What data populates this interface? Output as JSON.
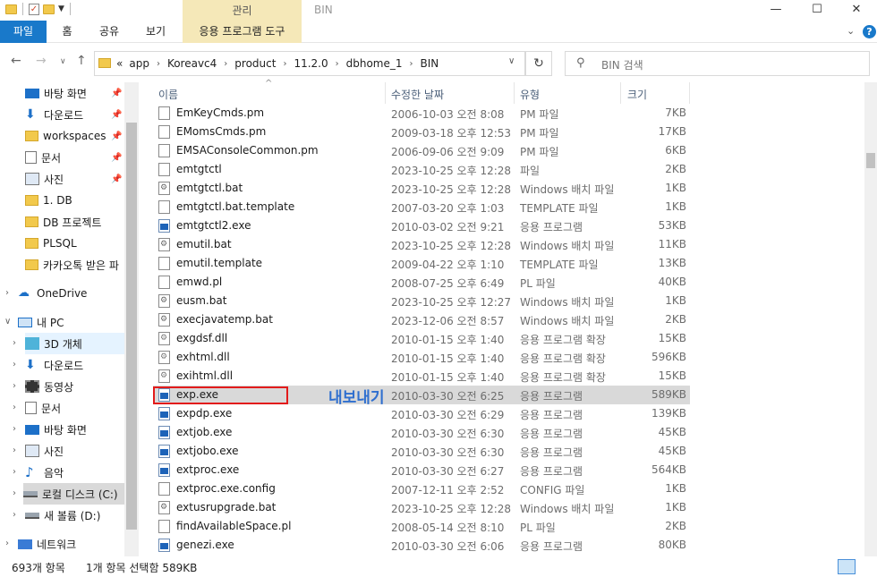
{
  "title_bar": {
    "contextual_tab": "관리",
    "window_title": "BIN",
    "minimize": "—",
    "maximize": "☐",
    "close": "✕"
  },
  "ribbon": {
    "file": "파일",
    "home": "홈",
    "share": "공유",
    "view": "보기",
    "app_tools": "응용 프로그램 도구"
  },
  "address": {
    "overflow": "«",
    "crumbs": [
      "app",
      "Koreavc4",
      "product",
      "11.2.0",
      "dbhome_1",
      "BIN"
    ]
  },
  "search": {
    "placeholder": "BIN 검색"
  },
  "sidebar": {
    "items": [
      {
        "label": "바탕 화면",
        "icon": "desktop-icon"
      },
      {
        "label": "다운로드",
        "icon": "download-arrow-icon"
      },
      {
        "label": "workspaces",
        "icon": "folder-icon"
      },
      {
        "label": "문서",
        "icon": "document-icon"
      },
      {
        "label": "사진",
        "icon": "picture-icon"
      },
      {
        "label": "1. DB",
        "icon": "folder-icon"
      },
      {
        "label": "DB 프로젝트",
        "icon": "folder-icon"
      },
      {
        "label": "PLSQL",
        "icon": "folder-icon"
      },
      {
        "label": "카카오톡 받은 파",
        "icon": "folder-icon"
      },
      {
        "label": "OneDrive",
        "icon": "cloud-icon"
      },
      {
        "label": "내 PC",
        "icon": "pc-icon"
      },
      {
        "label": "3D 개체",
        "icon": "3d-cube-icon"
      },
      {
        "label": "다운로드",
        "icon": "download-arrow-icon"
      },
      {
        "label": "동영상",
        "icon": "video-icon"
      },
      {
        "label": "문서",
        "icon": "document-icon"
      },
      {
        "label": "바탕 화면",
        "icon": "desktop-icon"
      },
      {
        "label": "사진",
        "icon": "picture-icon"
      },
      {
        "label": "음악",
        "icon": "music-icon"
      },
      {
        "label": "로컬 디스크 (C:)",
        "icon": "local-disk-icon"
      },
      {
        "label": "새 볼륨 (D:)",
        "icon": "drive-icon"
      },
      {
        "label": "네트워크",
        "icon": "network-icon"
      }
    ]
  },
  "columns": {
    "name": "이름",
    "date": "수정한 날짜",
    "type": "유형",
    "size": "크기"
  },
  "files": [
    {
      "name": "EmKeyCmds.pm",
      "date": "2006-10-03 오전 8:08",
      "type": "PM 파일",
      "size": "7KB",
      "kind": "file"
    },
    {
      "name": "EMomsCmds.pm",
      "date": "2009-03-18 오후 12:53",
      "type": "PM 파일",
      "size": "17KB",
      "kind": "file"
    },
    {
      "name": "EMSAConsoleCommon.pm",
      "date": "2006-09-06 오전 9:09",
      "type": "PM 파일",
      "size": "6KB",
      "kind": "file"
    },
    {
      "name": "emtgtctl",
      "date": "2023-10-25 오후 12:28",
      "type": "파일",
      "size": "2KB",
      "kind": "file"
    },
    {
      "name": "emtgtctl.bat",
      "date": "2023-10-25 오후 12:28",
      "type": "Windows 배치 파일",
      "size": "1KB",
      "kind": "bat"
    },
    {
      "name": "emtgtctl.bat.template",
      "date": "2007-03-20 오후 1:03",
      "type": "TEMPLATE 파일",
      "size": "1KB",
      "kind": "file"
    },
    {
      "name": "emtgtctl2.exe",
      "date": "2010-03-02 오전 9:21",
      "type": "응용 프로그램",
      "size": "53KB",
      "kind": "exe"
    },
    {
      "name": "emutil.bat",
      "date": "2023-10-25 오후 12:28",
      "type": "Windows 배치 파일",
      "size": "11KB",
      "kind": "bat"
    },
    {
      "name": "emutil.template",
      "date": "2009-04-22 오후 1:10",
      "type": "TEMPLATE 파일",
      "size": "13KB",
      "kind": "file"
    },
    {
      "name": "emwd.pl",
      "date": "2008-07-25 오후 6:49",
      "type": "PL 파일",
      "size": "40KB",
      "kind": "file"
    },
    {
      "name": "eusm.bat",
      "date": "2023-10-25 오후 12:27",
      "type": "Windows 배치 파일",
      "size": "1KB",
      "kind": "bat"
    },
    {
      "name": "execjavatemp.bat",
      "date": "2023-12-06 오전 8:57",
      "type": "Windows 배치 파일",
      "size": "2KB",
      "kind": "bat"
    },
    {
      "name": "exgdsf.dll",
      "date": "2010-01-15 오후 1:40",
      "type": "응용 프로그램 확장",
      "size": "15KB",
      "kind": "dll"
    },
    {
      "name": "exhtml.dll",
      "date": "2010-01-15 오후 1:40",
      "type": "응용 프로그램 확장",
      "size": "596KB",
      "kind": "dll"
    },
    {
      "name": "exihtml.dll",
      "date": "2010-01-15 오후 1:40",
      "type": "응용 프로그램 확장",
      "size": "15KB",
      "kind": "dll"
    },
    {
      "name": "exp.exe",
      "date": "2010-03-30 오전 6:25",
      "type": "응용 프로그램",
      "size": "589KB",
      "kind": "exe"
    },
    {
      "name": "expdp.exe",
      "date": "2010-03-30 오전 6:29",
      "type": "응용 프로그램",
      "size": "139KB",
      "kind": "exe"
    },
    {
      "name": "extjob.exe",
      "date": "2010-03-30 오전 6:30",
      "type": "응용 프로그램",
      "size": "45KB",
      "kind": "exe"
    },
    {
      "name": "extjobo.exe",
      "date": "2010-03-30 오전 6:30",
      "type": "응용 프로그램",
      "size": "45KB",
      "kind": "exe"
    },
    {
      "name": "extproc.exe",
      "date": "2010-03-30 오전 6:27",
      "type": "응용 프로그램",
      "size": "564KB",
      "kind": "exe"
    },
    {
      "name": "extproc.exe.config",
      "date": "2007-12-11 오후 2:52",
      "type": "CONFIG 파일",
      "size": "1KB",
      "kind": "file"
    },
    {
      "name": "extusrupgrade.bat",
      "date": "2023-10-25 오후 12:28",
      "type": "Windows 배치 파일",
      "size": "1KB",
      "kind": "bat"
    },
    {
      "name": "findAvailableSpace.pl",
      "date": "2008-05-14 오전 8:10",
      "type": "PL 파일",
      "size": "2KB",
      "kind": "file"
    },
    {
      "name": "genezi.exe",
      "date": "2010-03-30 오전 6:06",
      "type": "응용 프로그램",
      "size": "80KB",
      "kind": "exe"
    }
  ],
  "annotation": "내보내기",
  "status": {
    "count": "693개 항목",
    "selection": "1개 항목 선택함 589KB"
  },
  "colors": {
    "accent": "#1979ca",
    "selected_row": "#d9d9d9",
    "highlight_border": "#e21b1b",
    "annotation": "#2f6fcf",
    "contextual_tab": "#f5e8b8"
  }
}
